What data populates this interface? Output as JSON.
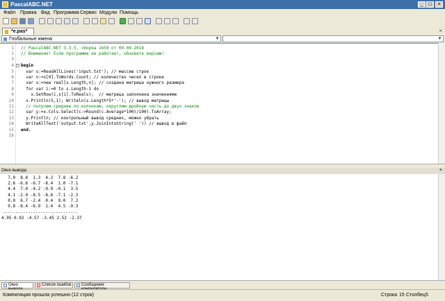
{
  "window": {
    "title": "PascalABC.NET"
  },
  "menu": [
    "Файл",
    "Правка",
    "Вид",
    "Программа",
    "Сервис",
    "Модули",
    "Помощь"
  ],
  "tab": {
    "label": "*e.pas*"
  },
  "scope_combo": {
    "value": "Глобальные имена"
  },
  "editor": {
    "line_numbers": [
      "1",
      "2",
      "3",
      "4",
      "5",
      "6",
      "7",
      "8",
      "9",
      "10",
      "11",
      "12",
      "13",
      "14",
      "15",
      "16"
    ],
    "lines": [
      "// PascalABC.NET 3.3.5, сборка 1659 от 09.04.2018",
      "// Внимание! Если программа не работает, обновите версию!",
      "",
      "begin",
      "  var s:=ReadAllLines('input.txt'); // массив строк",
      "  var n:=s[0].ToWords.Count; // количество чисел в строке",
      "  var x:=new real[s.Length,n]; // создана матрица нужного размера",
      "  for var i:=0 to s.Length-1 do",
      "    x.SetRow(i,s[i].ToReals);  // матрица заполнена значениями",
      "  x.Println(5,1); Writeln(s.Length*5*'-'); // вывод матрицы",
      "  // получим средние по колонкам, округлим дробную часть до двух знаков",
      "  var y:=x.Cols.Select(c->Round(c.Average*100)/100).ToArray;",
      "  y.Println; // контрольный вывод средних, можно убрать",
      "  WriteAllText('output.txt',y.JoinIntoString(' ')) // вывод в файл",
      "end.",
      ""
    ]
  },
  "output_panel": {
    "title": "Окно вывода",
    "lines": [
      "  7.9  8.8  1.3  4.2  7.8 -6.2",
      "  2.6 -6.6 -6.7 -8.4  1.0 -7.1",
      "  4.4  7.0 -4.2 -9.9 -0.1  3.5",
      "  4.1 -2.0 -8.5 -8.6 -7.1 -2.3",
      "  0.9  6.7 -2.4  0.4  9.0  7.2",
      "  9.8 -8.4 -6.9  1.4  4.5 -9.3",
      "------------------------------",
      "4.95 0.92 -4.57 -3.45 2.52 -2.37"
    ]
  },
  "bottom_tabs": [
    "Окно вывода",
    "Список ошибок",
    "Сообщения компилятора"
  ],
  "status": {
    "message": "Компиляция прошла успешно (12 строк)",
    "row_label": "Строка",
    "row_value": "15",
    "col_label": "Столбец",
    "col_value": "5"
  },
  "colors": {
    "titlebar": "#3d6fa8",
    "comment": "#0a8a0a",
    "string": "#0000c0"
  }
}
